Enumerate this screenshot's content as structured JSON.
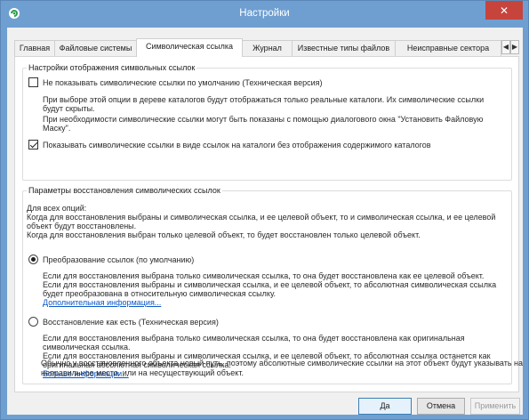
{
  "window": {
    "title": "Настройки",
    "close_glyph": "✕",
    "app_icon": "app-icon"
  },
  "tabs": [
    {
      "label": "Главная",
      "active": false
    },
    {
      "label": "Файловые системы",
      "active": false
    },
    {
      "label": "Символическая ссылка",
      "active": true
    },
    {
      "label": "Журнал",
      "active": false
    },
    {
      "label": "Известные типы файлов",
      "active": false
    },
    {
      "label": "Неисправные сектора",
      "active": false
    }
  ],
  "tab_scroll": {
    "left": "◀",
    "right": "▶"
  },
  "display_group": {
    "title": "Настройки отображения символьных ссылок",
    "option1": {
      "label": "Не показывать символические ссылки по умолчанию (Техническая версия)",
      "checked": false,
      "desc": [
        "При выборе этой опции в дереве каталогов будут отображаться только реальные каталоги. Их символические ссылки",
        "будут скрыты.",
        "При необходимости символические ссылки могут быть показаны с помощью диалогового окна \"Установить Файловую",
        "Маску\"."
      ]
    },
    "option2": {
      "label": "Показывать символические ссылки в виде ссылок на каталоги без отображения содержимого каталогов",
      "checked": true
    }
  },
  "restore_group": {
    "title": "Параметры восстановления символических ссылок",
    "intro": [
      "Для всех опций:",
      "Когда для восстановления выбраны и символическая ссылка, и ее целевой объект, то и символическая ссылка, и ее целевой",
      "объект будут восстановлены.",
      "Когда для восстановления выбран только целевой объект, то будет восстановлен только целевой объект."
    ],
    "radio1": {
      "label": "Преобразование ссылок (по умолчанию)",
      "checked": true,
      "desc": [
        "Если для восстановления выбрана только символическая ссылка, то она будет восстановлена как ее целевой объект.",
        "Если для восстановления выбраны и символическая ссылка, и ее целевой объект, то абсолютная символическая ссылка",
        "будет преобразована в относительную символическая ссылку."
      ],
      "link": "Дополнительная информация..."
    },
    "radio2": {
      "label": "Восстановление как есть (Техническая версия)",
      "checked": false,
      "desc": [
        "Если для восстановления выбрана только символическая ссылка, то она будет восстановлена как оригинальная",
        "символическая ссылка.",
        "Если для восстановления выбраны и символическая ссылка, и ее целевой объект, то абсолютная ссылка останется как",
        "оригинальная абсолютная символическая ссылка."
      ],
      "link": "Больше информации...",
      "note": [
        "Обычно у восстановленного объекта новый путь, поэтому абсолютные символические ссылки на этот объект будут указывать на",
        "неправильное место. или на несуществующий объект."
      ]
    }
  },
  "footer": {
    "ok": "Да",
    "cancel": "Отмена",
    "apply": "Применить"
  }
}
